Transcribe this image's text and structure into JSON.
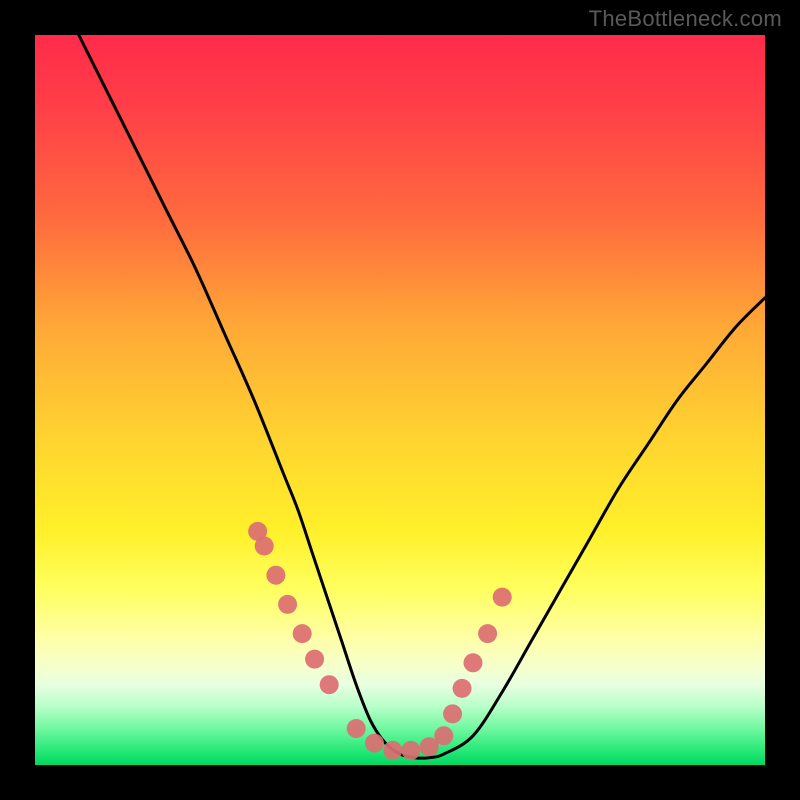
{
  "watermark": "TheBottleneck.com",
  "chart_data": {
    "type": "line",
    "title": "",
    "xlabel": "",
    "ylabel": "",
    "ylim": [
      0,
      100
    ],
    "xlim": [
      0,
      100
    ],
    "series": [
      {
        "name": "bottleneck-curve",
        "x": [
          6,
          10,
          14,
          18,
          22,
          26,
          30,
          34,
          36,
          38,
          40,
          42,
          44,
          46,
          48,
          50,
          52,
          54,
          56,
          60,
          64,
          68,
          72,
          76,
          80,
          84,
          88,
          92,
          96,
          100
        ],
        "y": [
          100,
          92,
          84,
          76,
          68,
          59,
          50,
          40,
          35,
          29,
          23,
          17,
          11,
          6,
          3,
          1.5,
          1,
          1,
          1.5,
          4,
          10,
          17,
          24,
          31,
          38,
          44,
          50,
          55,
          60,
          64
        ]
      }
    ],
    "markers": {
      "name": "highlight-dots",
      "x": [
        30.5,
        31.4,
        33.0,
        34.6,
        36.6,
        38.3,
        40.3,
        44.0,
        46.5,
        49.0,
        51.5,
        54.0,
        56.0,
        57.2,
        58.5,
        60.0,
        62.0,
        64.0
      ],
      "y": [
        32,
        30,
        26,
        22,
        18,
        14.5,
        11,
        5,
        3,
        2,
        2,
        2.5,
        4,
        7,
        10.5,
        14,
        18,
        23
      ]
    },
    "gradient_stops": [
      {
        "pos": 0,
        "color": "#ff2b4a"
      },
      {
        "pos": 25,
        "color": "#ff6a3e"
      },
      {
        "pos": 55,
        "color": "#ffd330"
      },
      {
        "pos": 76,
        "color": "#ffff60"
      },
      {
        "pos": 95,
        "color": "#70f8a0"
      },
      {
        "pos": 100,
        "color": "#00d860"
      }
    ]
  }
}
